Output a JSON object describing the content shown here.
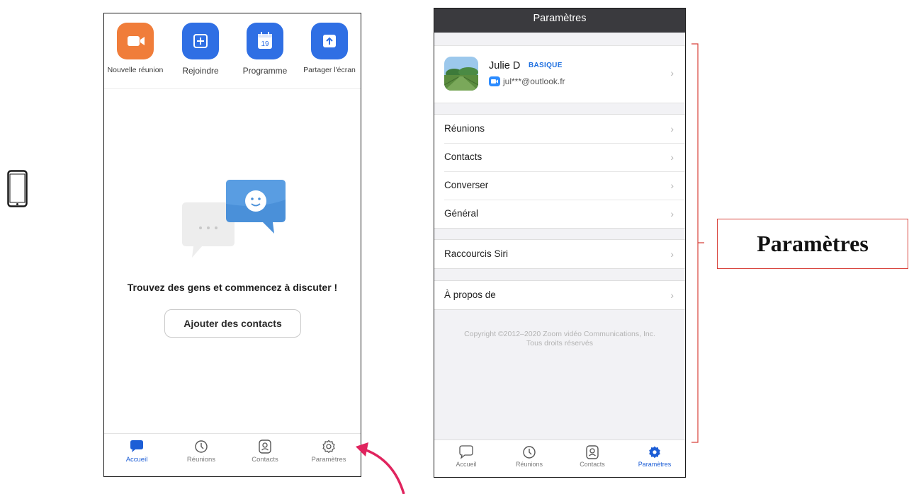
{
  "left_screen": {
    "actions": [
      {
        "label": "Nouvelle réunion",
        "icon": "video-camera-icon",
        "color": "#F07D3A"
      },
      {
        "label": "Rejoindre",
        "icon": "plus-icon",
        "color": "#2F6FE4"
      },
      {
        "label": "Programme",
        "icon": "calendar-icon",
        "color": "#2F6FE4",
        "calendar_day": "19"
      },
      {
        "label": "Partager l'écran",
        "icon": "share-up-arrow-icon",
        "color": "#2F6FE4"
      }
    ],
    "empty_state": {
      "title": "Trouvez des gens et commencez à discuter !",
      "button": "Ajouter des contacts"
    },
    "bottom_nav": [
      {
        "label": "Accueil",
        "icon": "chat-bubble-icon",
        "active": true
      },
      {
        "label": "Réunions",
        "icon": "clock-icon",
        "active": false
      },
      {
        "label": "Contacts",
        "icon": "contact-card-icon",
        "active": false
      },
      {
        "label": "Paramètres",
        "icon": "gear-icon",
        "active": false
      }
    ]
  },
  "right_screen": {
    "header_title": "Paramètres",
    "profile": {
      "name": "Julie D",
      "plan_badge": "BASIQUE",
      "email": "jul***@outlook.fr"
    },
    "groups": [
      [
        "Réunions",
        "Contacts",
        "Converser",
        "Général"
      ],
      [
        "Raccourcis Siri"
      ],
      [
        "À propos de"
      ]
    ],
    "copyright_line1": "Copyright ©2012–2020 Zoom vidéo Communications, Inc.",
    "copyright_line2": "Tous droits réservés",
    "bottom_nav": [
      {
        "label": "Accueil",
        "icon": "chat-bubble-icon",
        "active": false
      },
      {
        "label": "Réunions",
        "icon": "clock-icon",
        "active": false
      },
      {
        "label": "Contacts",
        "icon": "contact-card-icon",
        "active": false
      },
      {
        "label": "Paramètres",
        "icon": "gear-icon",
        "active": true
      }
    ]
  },
  "callout_label": "Paramètres",
  "colors": {
    "accent_blue": "#1D5ED6",
    "orange": "#F07D3A",
    "annotation_red": "#D8423A",
    "header_dark": "#3A3A3E"
  }
}
